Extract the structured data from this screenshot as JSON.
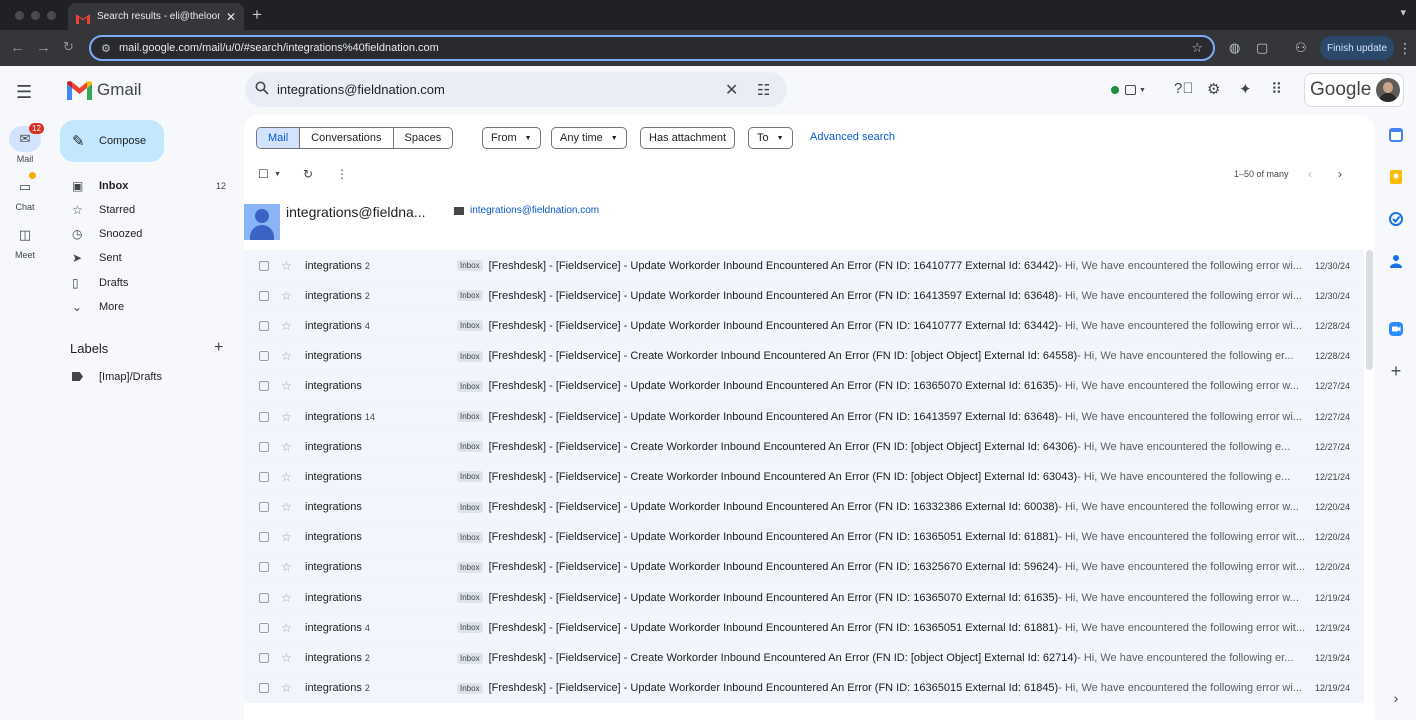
{
  "browser": {
    "tab_title": "Search results - eli@theloom",
    "url": "mail.google.com/mail/u/0/#search/integrations%40fieldnation.com",
    "finish_update": "Finish update"
  },
  "header": {
    "app_name": "Gmail",
    "search_query": "integrations@fieldnation.com",
    "brand_word": "Google"
  },
  "rail": [
    {
      "label": "Mail",
      "badge": "12"
    },
    {
      "label": "Chat"
    },
    {
      "label": "Meet"
    }
  ],
  "compose_label": "Compose",
  "nav": [
    {
      "label": "Inbox",
      "count": "12"
    },
    {
      "label": "Starred"
    },
    {
      "label": "Snoozed"
    },
    {
      "label": "Sent"
    },
    {
      "label": "Drafts"
    },
    {
      "label": "More"
    }
  ],
  "labels_heading": "Labels",
  "labels": [
    {
      "label": "[Imap]/Drafts"
    }
  ],
  "filters": {
    "scopes": [
      "Mail",
      "Conversations",
      "Spaces"
    ],
    "from": "From",
    "any_time": "Any time",
    "has_attachment": "Has attachment",
    "to": "To",
    "advanced": "Advanced search"
  },
  "pager": "1–50 of many",
  "contact": {
    "name": "integrations@fieldna...",
    "email": "integrations@fieldnation.com"
  },
  "inbox_label": "Inbox",
  "rows": [
    {
      "from": "integrations",
      "count": "2",
      "subject": "[Freshdesk] - [Fieldservice] - Update Workorder Inbound Encountered An Error (FN ID: 16410777 External Id: 63442)",
      "snippet": " - Hi, We have encountered the following error wi...",
      "date": "12/30/24"
    },
    {
      "from": "integrations",
      "count": "2",
      "subject": "[Freshdesk] - [Fieldservice] - Update Workorder Inbound Encountered An Error (FN ID: 16413597 External Id: 63648)",
      "snippet": " - Hi, We have encountered the following error wi...",
      "date": "12/30/24"
    },
    {
      "from": "integrations",
      "count": "4",
      "subject": "[Freshdesk] - [Fieldservice] - Update Workorder Inbound Encountered An Error (FN ID: 16410777 External Id: 63442)",
      "snippet": " - Hi, We have encountered the following error wi...",
      "date": "12/28/24"
    },
    {
      "from": "integrations",
      "count": "",
      "subject": "[Freshdesk] - [Fieldservice] - Create Workorder Inbound Encountered An Error (FN ID: [object Object] External Id: 64558)",
      "snippet": " - Hi, We have encountered the following er...",
      "date": "12/28/24"
    },
    {
      "from": "integrations",
      "count": "",
      "subject": "[Freshdesk] - [Fieldservice] - Update Workorder Inbound Encountered An Error (FN ID: 16365070 External Id: 61635)",
      "snippet": " - Hi, We have encountered the following error w...",
      "date": "12/27/24"
    },
    {
      "from": "integrations",
      "count": "14",
      "subject": "[Freshdesk] - [Fieldservice] - Update Workorder Inbound Encountered An Error (FN ID: 16413597 External Id: 63648)",
      "snippet": " - Hi, We have encountered the following error wi...",
      "date": "12/27/24"
    },
    {
      "from": "integrations",
      "count": "",
      "subject": "[Freshdesk] - [Fieldservice] - Create Workorder Inbound Encountered An Error (FN ID: [object Object] External Id: 64306)",
      "snippet": " - Hi, We have encountered the following e...",
      "date": "12/27/24"
    },
    {
      "from": "integrations",
      "count": "",
      "subject": "[Freshdesk] - [Fieldservice] - Create Workorder Inbound Encountered An Error (FN ID: [object Object] External Id: 63043)",
      "snippet": " - Hi, We have encountered the following e...",
      "date": "12/21/24"
    },
    {
      "from": "integrations",
      "count": "",
      "subject": "[Freshdesk] - [Fieldservice] - Update Workorder Inbound Encountered An Error (FN ID: 16332386 External Id: 60038)",
      "snippet": " - Hi, We have encountered the following error w...",
      "date": "12/20/24"
    },
    {
      "from": "integrations",
      "count": "",
      "subject": "[Freshdesk] - [Fieldservice] - Update Workorder Inbound Encountered An Error (FN ID: 16365051 External Id: 61881)",
      "snippet": " - Hi, We have encountered the following error wit...",
      "date": "12/20/24"
    },
    {
      "from": "integrations",
      "count": "",
      "subject": "[Freshdesk] - [Fieldservice] - Update Workorder Inbound Encountered An Error (FN ID: 16325670 External Id: 59624)",
      "snippet": " - Hi, We have encountered the following error wit...",
      "date": "12/20/24"
    },
    {
      "from": "integrations",
      "count": "",
      "subject": "[Freshdesk] - [Fieldservice] - Update Workorder Inbound Encountered An Error (FN ID: 16365070 External Id: 61635)",
      "snippet": " - Hi, We have encountered the following error w...",
      "date": "12/19/24"
    },
    {
      "from": "integrations",
      "count": "4",
      "subject": "[Freshdesk] - [Fieldservice] - Update Workorder Inbound Encountered An Error (FN ID: 16365051 External Id: 61881)",
      "snippet": " - Hi, We have encountered the following error wit...",
      "date": "12/19/24"
    },
    {
      "from": "integrations",
      "count": "2",
      "subject": "[Freshdesk] - [Fieldservice] - Create Workorder Inbound Encountered An Error (FN ID: [object Object] External Id: 62714)",
      "snippet": " - Hi, We have encountered the following er...",
      "date": "12/19/24"
    },
    {
      "from": "integrations",
      "count": "2",
      "subject": "[Freshdesk] - [Fieldservice] - Update Workorder Inbound Encountered An Error (FN ID: 16365015 External Id: 61845)",
      "snippet": " - Hi, We have encountered the following error wi...",
      "date": "12/19/24"
    }
  ],
  "colors": {
    "accent": "#0b57d0",
    "compose_bg": "#c2e7ff",
    "badge": "#d93025",
    "status_green": "#1e8e3e"
  }
}
